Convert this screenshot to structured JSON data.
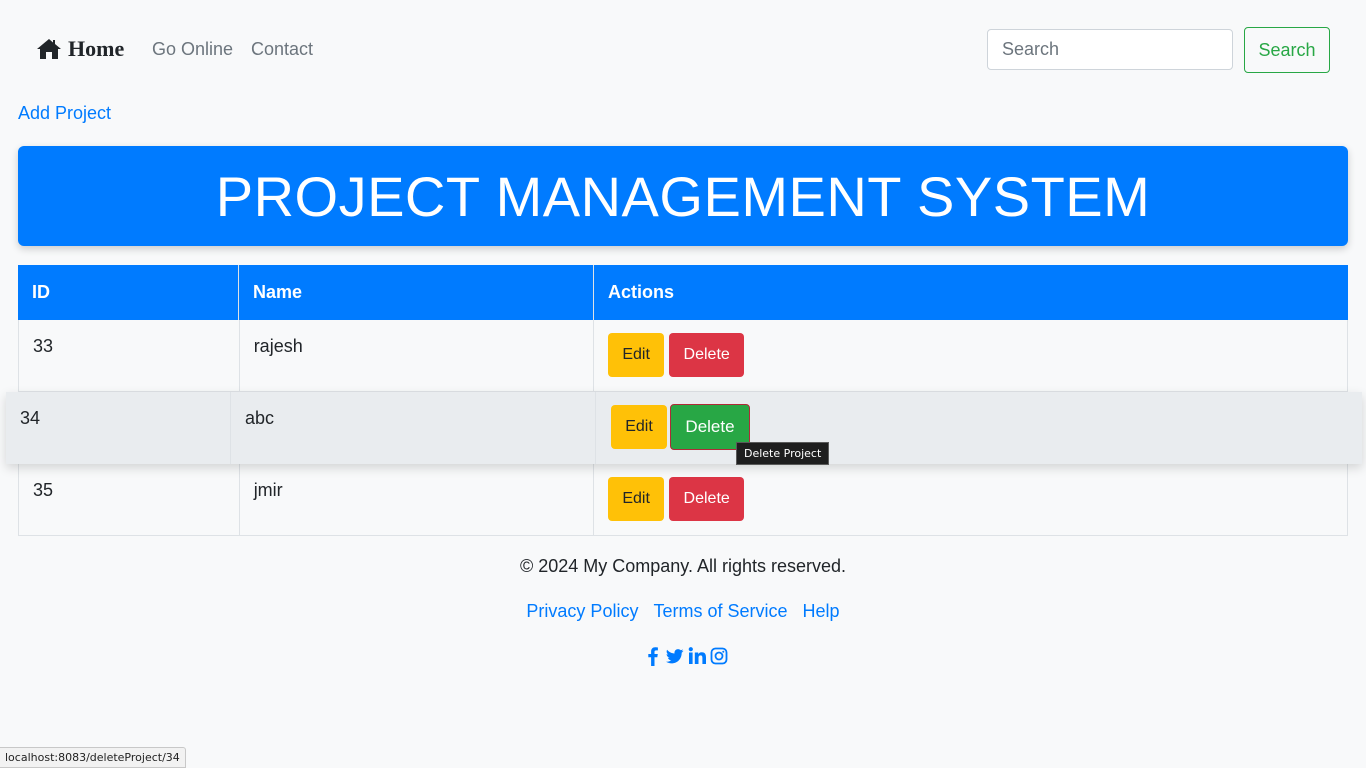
{
  "navbar": {
    "brand_label": "Home",
    "brand_icon": "home-icon",
    "links": [
      "Go Online",
      "Contact"
    ],
    "search_placeholder": "Search",
    "search_button": "Search"
  },
  "add_project_label": "Add Project",
  "banner_title": "PROJECT MANAGEMENT SYSTEM",
  "table": {
    "headers": [
      "ID",
      "Name",
      "Actions"
    ],
    "rows": [
      {
        "id": "33",
        "name": "rajesh"
      },
      {
        "id": "34",
        "name": "abc"
      },
      {
        "id": "35",
        "name": "jmir"
      }
    ],
    "edit_label": "Edit",
    "delete_label": "Delete"
  },
  "tooltip": "Delete Project",
  "footer": {
    "copyright": "© 2024 My Company. All rights reserved.",
    "links": [
      "Privacy Policy",
      "Terms of Service",
      "Help"
    ],
    "social_icons": [
      "facebook-icon",
      "twitter-icon",
      "linkedin-icon",
      "instagram-icon"
    ]
  },
  "status_bar_url": "localhost:8083/deleteProject/34",
  "colors": {
    "primary": "#007bff",
    "success": "#28a745",
    "warning": "#ffc107",
    "danger": "#dc3545"
  }
}
